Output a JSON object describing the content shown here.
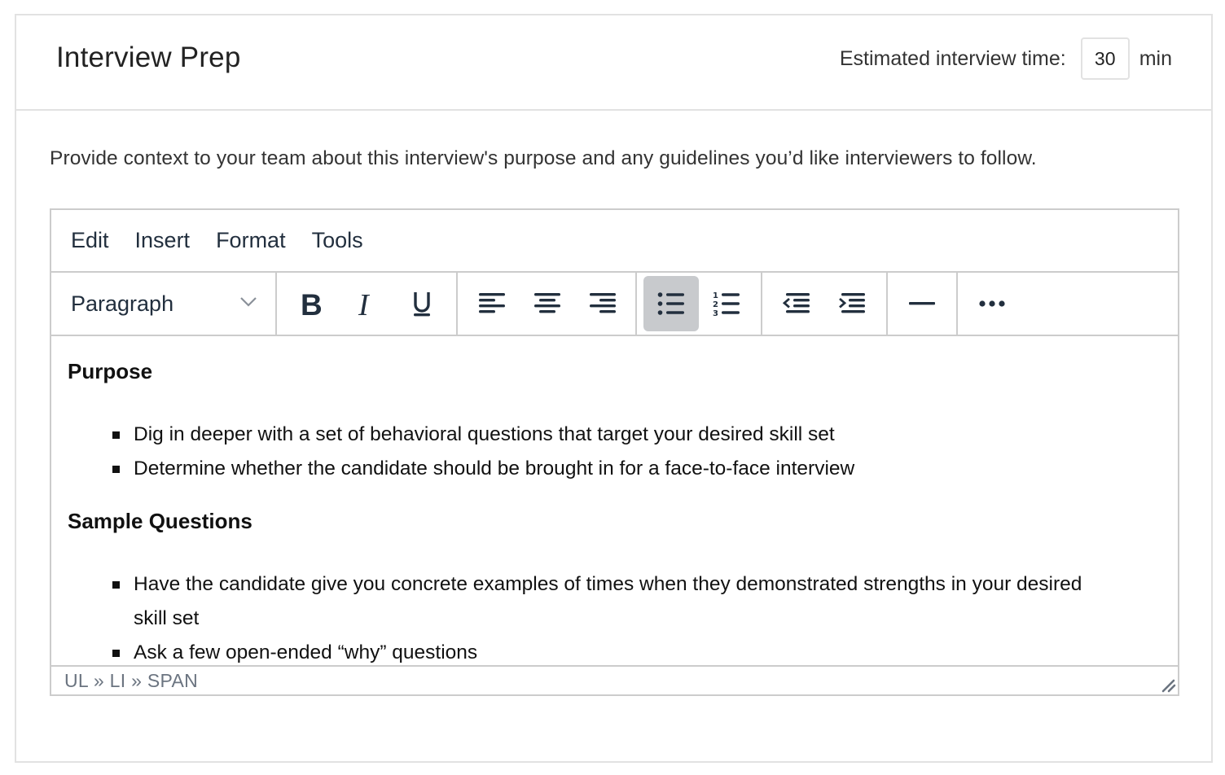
{
  "header": {
    "title": "Interview Prep",
    "time_label": "Estimated interview time:",
    "time_value": "30",
    "time_unit": "min"
  },
  "description": "Provide context to your team about this interview's purpose and any guidelines you’d like interviewers to follow.",
  "editor": {
    "menu": [
      "Edit",
      "Insert",
      "Format",
      "Tools"
    ],
    "toolbar": {
      "block_format": "Paragraph",
      "buttons": [
        {
          "icon": "bold-icon",
          "label": "B"
        },
        {
          "icon": "italic-icon",
          "label": "I"
        },
        {
          "icon": "underline-icon",
          "label": "U"
        },
        {
          "icon": "align-left-icon"
        },
        {
          "icon": "align-center-icon"
        },
        {
          "icon": "align-right-icon"
        },
        {
          "icon": "bullet-list-icon",
          "active": true
        },
        {
          "icon": "numbered-list-icon"
        },
        {
          "icon": "outdent-icon"
        },
        {
          "icon": "indent-icon"
        },
        {
          "icon": "horizontal-rule-icon"
        },
        {
          "icon": "more-icon"
        }
      ],
      "active_color": "#c8cacd",
      "icon_color": "#222f3e"
    },
    "content": {
      "sections": [
        {
          "heading": "Purpose",
          "items": [
            "Dig in deeper with a set of behavioral questions that target your desired skill set",
            "Determine whether the candidate should be brought in for a face-to-face interview"
          ]
        },
        {
          "heading": "Sample Questions",
          "items": [
            "Have the candidate give you concrete examples of times when they demonstrated strengths in your desired skill set",
            "Ask a few open-ended “why” questions"
          ]
        }
      ]
    },
    "status_path": "UL » LI » SPAN"
  }
}
